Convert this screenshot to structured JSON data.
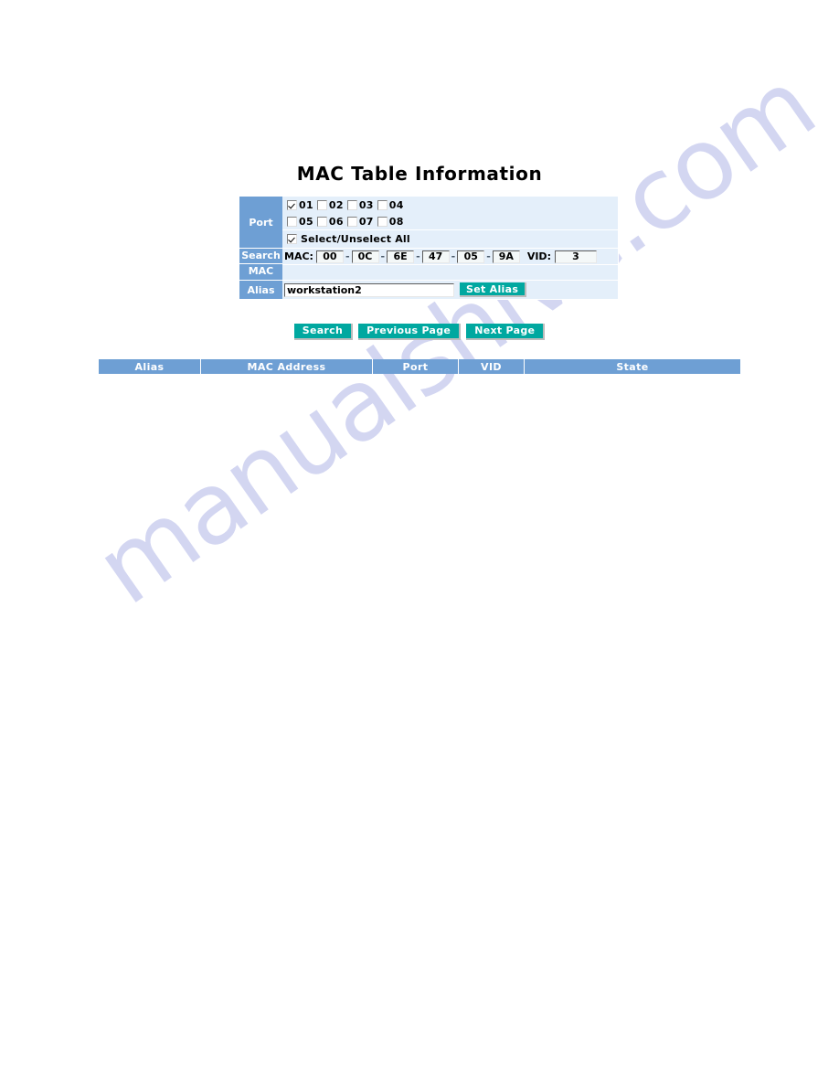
{
  "page": {
    "title": "MAC Table Information",
    "watermark": "manualshive.com"
  },
  "colors": {
    "label_blue": "#6e9fd4",
    "panel_bg": "#e4effa",
    "button_teal": "#00a8a0",
    "header_blue": "#6e9fd4",
    "watermark": "#c7cbee"
  },
  "form": {
    "port": {
      "label": "Port",
      "checkboxes": [
        {
          "label": "01",
          "checked": true
        },
        {
          "label": "02",
          "checked": false
        },
        {
          "label": "03",
          "checked": false
        },
        {
          "label": "04",
          "checked": false
        },
        {
          "label": "05",
          "checked": false
        },
        {
          "label": "06",
          "checked": false
        },
        {
          "label": "07",
          "checked": false
        },
        {
          "label": "08",
          "checked": false
        }
      ],
      "select_all": {
        "label": "Select/Unselect All",
        "checked": true
      }
    },
    "search_mac": {
      "label_line1": "Search",
      "label_line2": "MAC",
      "mac_caption": "MAC:",
      "mac_octets": [
        "00",
        "0C",
        "6E",
        "47",
        "05",
        "9A"
      ],
      "separator": "-",
      "vid_caption": "VID:",
      "vid_value": "3"
    },
    "alias": {
      "label": "Alias",
      "value": "workstation2",
      "placeholder": "",
      "set_button": "Set Alias"
    }
  },
  "actions": {
    "search": "Search",
    "previous_page": "Previous Page",
    "next_page": "Next Page"
  },
  "results": {
    "columns": [
      "Alias",
      "MAC Address",
      "Port",
      "VID",
      "State"
    ],
    "rows": []
  }
}
